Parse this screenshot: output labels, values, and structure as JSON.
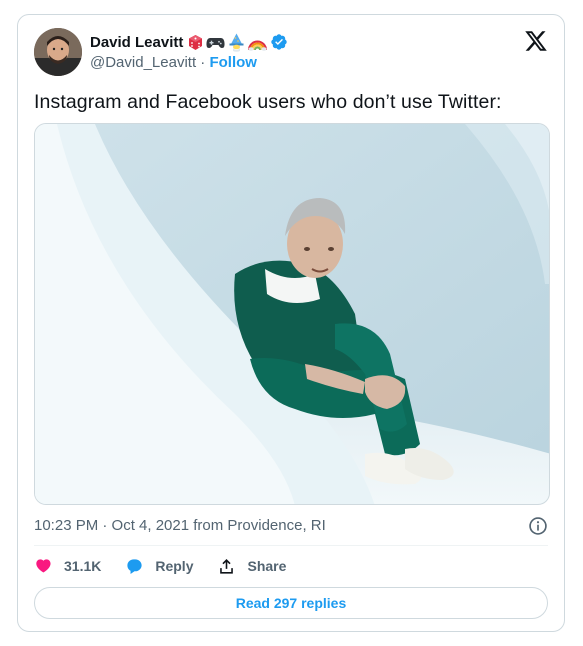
{
  "author": {
    "name": "David Leavitt",
    "name_emoji": [
      "game-die-icon",
      "game-controller-icon",
      "wizard-icon",
      "rainbow-icon"
    ],
    "verified": true,
    "handle": "@David_Leavitt",
    "separator": " · ",
    "follow_label": "Follow"
  },
  "tweet": {
    "text": "Instagram and Facebook users who don’t use Twitter:",
    "timestamp": "10:23 PM · Oct 4, 2021 from Providence, RI"
  },
  "actions": {
    "like_count": "31.1K",
    "reply_label": "Reply",
    "share_label": "Share"
  },
  "read_replies_label": "Read 297 replies",
  "colors": {
    "accent": "#1d9bf0",
    "like": "#f91880",
    "secondary_text": "#536471",
    "border": "#cfd9de"
  }
}
